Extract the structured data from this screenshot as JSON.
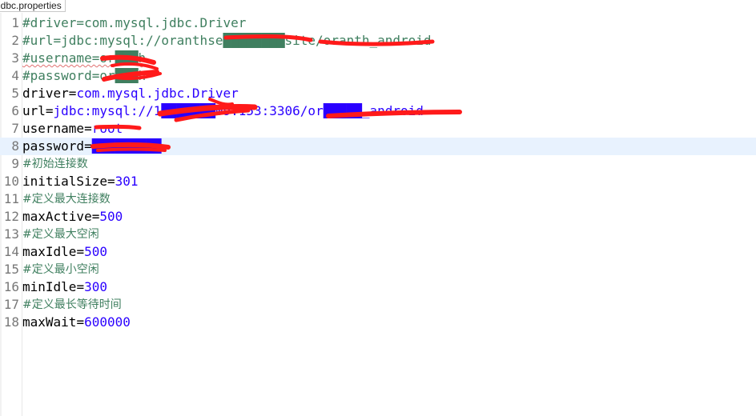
{
  "tab": {
    "title": "jdbc.properties"
  },
  "lines": [
    {
      "number": "1",
      "kind": "comment",
      "text": "#driver=com.mysql.jdbc.Driver"
    },
    {
      "number": "2",
      "kind": "comment",
      "text": "#url=jdbc:mysql://oranthse████████site/oranth_android"
    },
    {
      "number": "3",
      "kind": "comment",
      "text": "#username=or███h"
    },
    {
      "number": "4",
      "kind": "comment",
      "text": "#password=or███h"
    },
    {
      "number": "5",
      "kind": "property",
      "key": "driver",
      "value": "com.mysql.jdbc.Driver"
    },
    {
      "number": "6",
      "kind": "property",
      "key": "url",
      "value": "jdbc:mysql://1███████09.153:3306/or█████_android"
    },
    {
      "number": "7",
      "kind": "property",
      "key": "username",
      "value": "root"
    },
    {
      "number": "8",
      "kind": "property",
      "key": "password",
      "value": "█████████"
    },
    {
      "number": "9",
      "kind": "comment",
      "text": "#初始连接数"
    },
    {
      "number": "10",
      "kind": "property",
      "key": "initialSize",
      "value": "301"
    },
    {
      "number": "11",
      "kind": "comment",
      "text": "#定义最大连接数"
    },
    {
      "number": "12",
      "kind": "property",
      "key": "maxActive",
      "value": "500"
    },
    {
      "number": "13",
      "kind": "comment",
      "text": "#定义最大空闲"
    },
    {
      "number": "14",
      "kind": "property",
      "key": "maxIdle",
      "value": "500"
    },
    {
      "number": "15",
      "kind": "comment",
      "text": "#定义最小空闲"
    },
    {
      "number": "16",
      "kind": "property",
      "key": "minIdle",
      "value": "300"
    },
    {
      "number": "17",
      "kind": "comment",
      "text": "#定义最长等待时间"
    },
    {
      "number": "18",
      "kind": "property",
      "key": "maxWait",
      "value": "600000"
    }
  ],
  "current_line": "8",
  "colors": {
    "comment": "#3f7f5f",
    "value": "#2a00ff",
    "key": "#000000",
    "line_number": "#787878",
    "current_line_bg": "#e8f2fe",
    "redaction": "#ff1a1a"
  }
}
